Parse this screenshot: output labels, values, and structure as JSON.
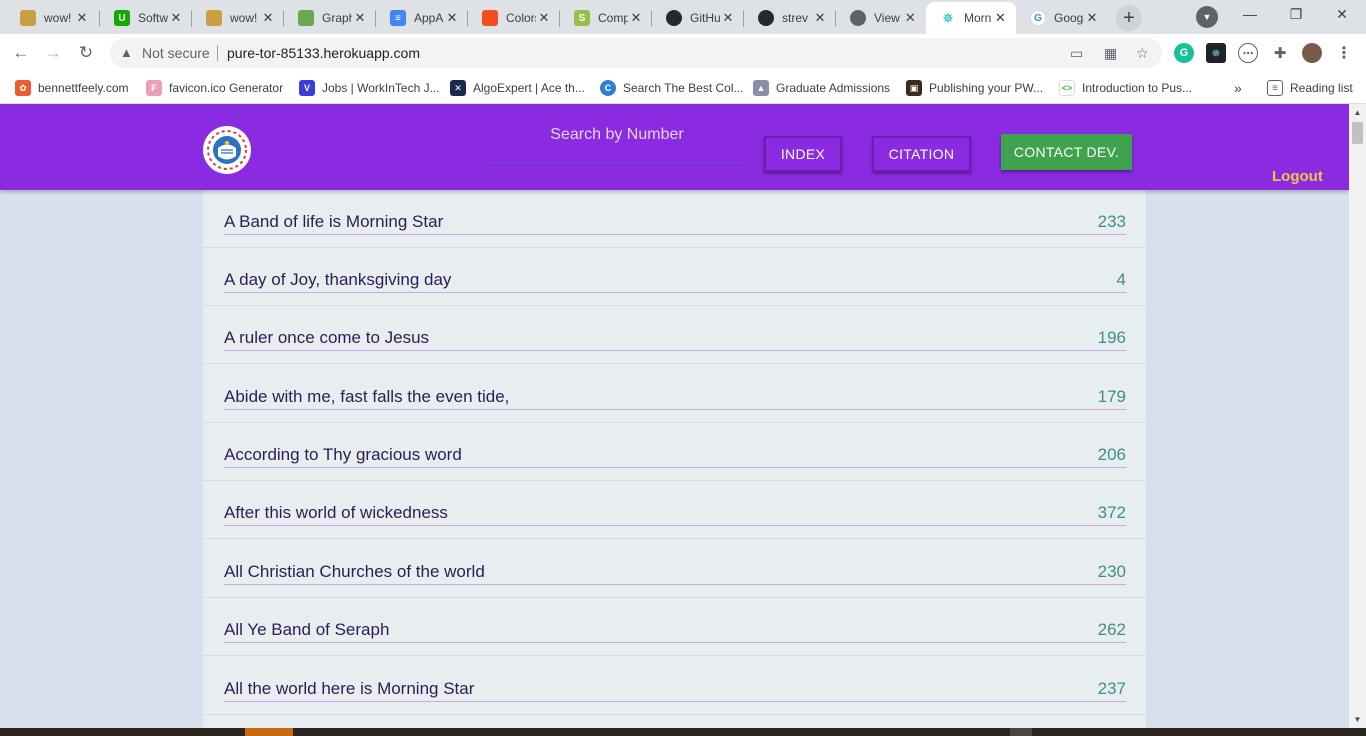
{
  "browser": {
    "tabs": [
      {
        "title": "wow!",
        "icon": "doge-icon",
        "color": "#c8a040"
      },
      {
        "title": "Software",
        "icon": "upwork-icon",
        "color": "#14a800"
      },
      {
        "title": "wow!",
        "icon": "doge-icon",
        "color": "#c8a040"
      },
      {
        "title": "Graph",
        "icon": "graph-icon",
        "color": "#6aa84f"
      },
      {
        "title": "AppA",
        "icon": "docs-icon",
        "color": "#4285f4"
      },
      {
        "title": "Colors",
        "icon": "figma-icon",
        "color": "#f24e1e"
      },
      {
        "title": "Comp",
        "icon": "shopify-icon",
        "color": "#95bf47"
      },
      {
        "title": "GitHub",
        "icon": "github-icon",
        "color": "#24292e"
      },
      {
        "title": "strev",
        "icon": "github-icon",
        "color": "#24292e"
      },
      {
        "title": "View",
        "icon": "globe-icon",
        "color": "#5f6368"
      },
      {
        "title": "Morn",
        "icon": "react-icon",
        "color": "#00bcd4",
        "active": true
      },
      {
        "title": "Goog",
        "icon": "google-icon",
        "color": "#4285f4"
      }
    ],
    "new_tab": "+",
    "close_glyph": "✕",
    "security_label": "Not secure",
    "url": "pure-tor-85133.herokuapp.com",
    "bookmarks": [
      {
        "label": "bennettfeely.com",
        "icon": "bennett-icon",
        "color": "#e95f33"
      },
      {
        "label": "favicon.ico Generator",
        "icon": "favicon-icon",
        "color": "#e8a0b4"
      },
      {
        "label": "Jobs | WorkInTech J...",
        "icon": "workintech-icon",
        "color": "#3b3fd8"
      },
      {
        "label": "AlgoExpert | Ace th...",
        "icon": "algoexpert-icon",
        "color": "#1a2a4a"
      },
      {
        "label": "Search The Best Col...",
        "icon": "colorhunt-icon",
        "color": "#2d7fd3"
      },
      {
        "label": "Graduate Admissions",
        "icon": "university-icon",
        "color": "#8a8fa8"
      },
      {
        "label": "Publishing your PW...",
        "icon": "pwa-icon",
        "color": "#3c2a1e"
      },
      {
        "label": "Introduction to Pus...",
        "icon": "code-icon",
        "color": "#4caf50"
      }
    ],
    "more_bookmarks": "»",
    "reading_list": "Reading list"
  },
  "app": {
    "search_placeholder": "Search by Number",
    "buttons": {
      "index": "INDEX",
      "citation": "CITATION",
      "contact": "CONTACT DEV."
    },
    "logout": "Logout",
    "colors": {
      "header": "#8a2be2",
      "contact_button": "#3fa34d",
      "logout": "#f4c542",
      "hymn_number": "#3d8f86"
    },
    "hymns": [
      {
        "title": "A Band of life is Morning Star",
        "number": "233"
      },
      {
        "title": "A day of Joy, thanksgiving day",
        "number": "4"
      },
      {
        "title": "A ruler once come to Jesus",
        "number": "196"
      },
      {
        "title": "Abide with me, fast falls the even tide,",
        "number": "179"
      },
      {
        "title": "According to Thy gracious word",
        "number": "206"
      },
      {
        "title": "After this world of wickedness",
        "number": "372"
      },
      {
        "title": "All Christian Churches of the world",
        "number": "230"
      },
      {
        "title": "All Ye Band of Seraph",
        "number": "262"
      },
      {
        "title": "All the world here is Morning Star",
        "number": "237"
      }
    ]
  }
}
